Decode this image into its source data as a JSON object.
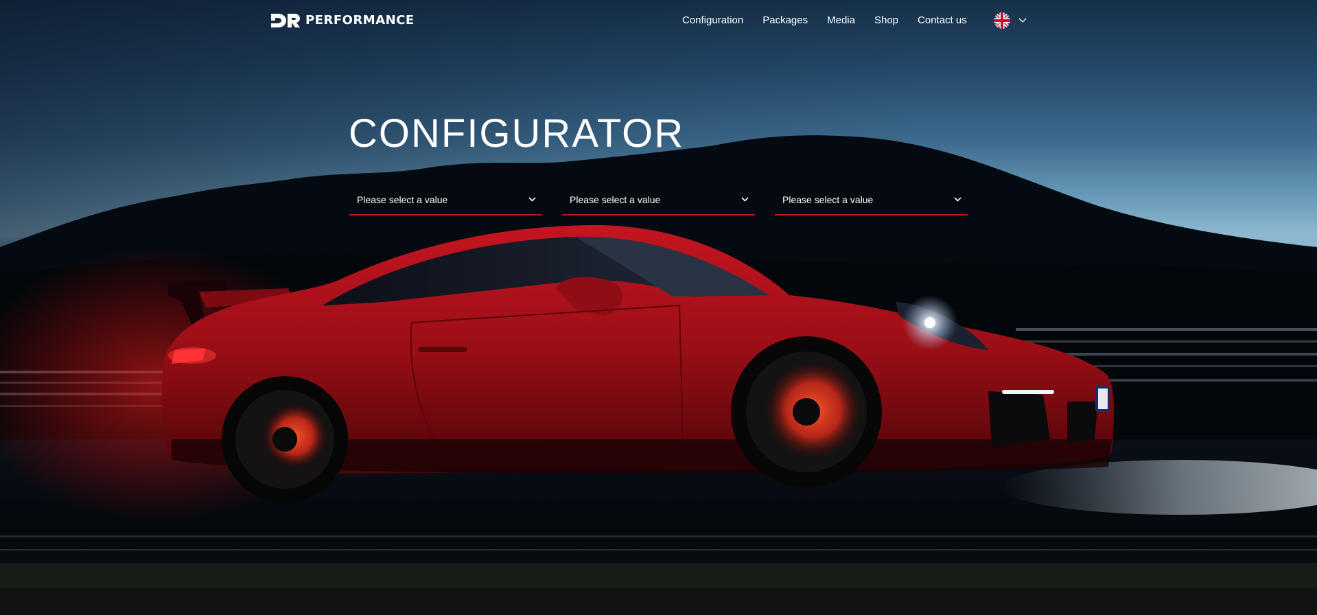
{
  "brand": {
    "logo_text": "PERFORMANCE",
    "logo_mark": "DR"
  },
  "nav": {
    "items": [
      "Configuration",
      "Packages",
      "Media",
      "Shop",
      "Contact us"
    ]
  },
  "language": {
    "flag_icon": "uk-flag-icon",
    "dropdown_icon": "chevron-down-icon"
  },
  "hero": {
    "title": "CONFIGURATOR",
    "selects": [
      {
        "placeholder": "Please select a value"
      },
      {
        "placeholder": "Please select a value"
      },
      {
        "placeholder": "Please select a value"
      }
    ]
  },
  "colors": {
    "accent": "#c0141c",
    "car_red": "#b0121a",
    "text": "#ffffff",
    "footer": "#121212"
  }
}
